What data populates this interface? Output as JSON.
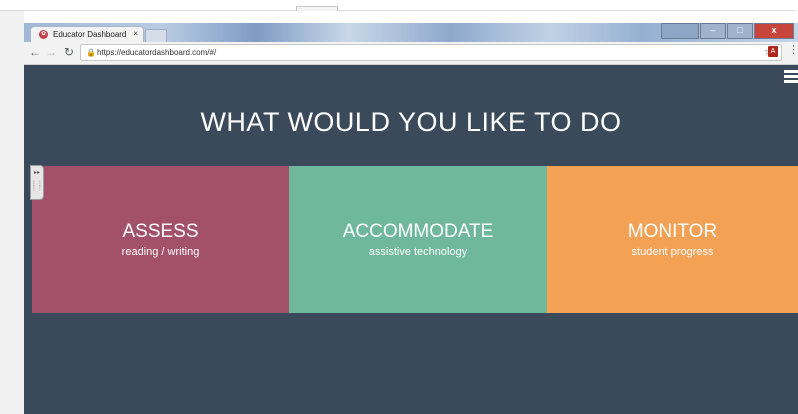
{
  "browser": {
    "tab_title": "Educator Dashboard",
    "tab_close": "×",
    "favicon": "educator-dashboard-icon",
    "url": "https://educatordashboard.com/#/",
    "window_controls": {
      "minimize": "–",
      "maximize": "□",
      "close": "x"
    }
  },
  "page": {
    "headline": "WHAT WOULD YOU LIKE TO DO",
    "tiles": [
      {
        "title": "ASSESS",
        "subtitle": "reading / writing",
        "color": "#a3506a"
      },
      {
        "title": "ACCOMMODATE",
        "subtitle": "assistive technology",
        "color": "#6fb89d"
      },
      {
        "title": "MONITOR",
        "subtitle": "student progress",
        "color": "#f2a155"
      }
    ],
    "background_color": "#3b4a5b"
  }
}
